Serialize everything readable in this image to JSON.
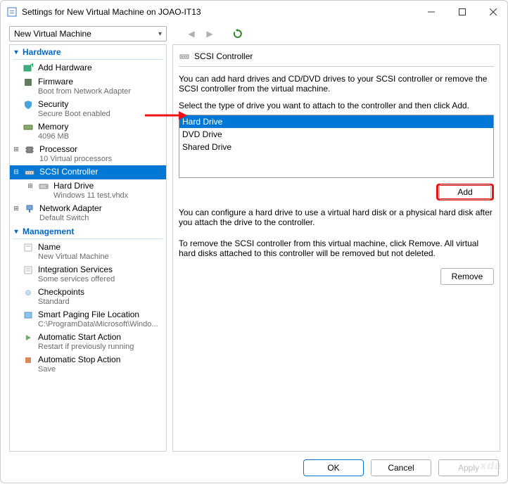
{
  "window": {
    "title": "Settings for New Virtual Machine on JOAO-IT13"
  },
  "toolbar": {
    "vm_name": "New Virtual Machine"
  },
  "sections": {
    "hardware": "Hardware",
    "management": "Management"
  },
  "tree": {
    "add_hardware": "Add Hardware",
    "firmware": "Firmware",
    "firmware_sub": "Boot from Network Adapter",
    "security": "Security",
    "security_sub": "Secure Boot enabled",
    "memory": "Memory",
    "memory_sub": "4096 MB",
    "processor": "Processor",
    "processor_sub": "10 Virtual processors",
    "scsi": "SCSI Controller",
    "hard_drive": "Hard Drive",
    "hard_drive_sub": "Windows 11 test.vhdx",
    "net": "Network Adapter",
    "net_sub": "Default Switch",
    "name": "Name",
    "name_sub": "New Virtual Machine",
    "integ": "Integration Services",
    "integ_sub": "Some services offered",
    "check": "Checkpoints",
    "check_sub": "Standard",
    "smart": "Smart Paging File Location",
    "smart_sub": "C:\\ProgramData\\Microsoft\\Windo...",
    "astart": "Automatic Start Action",
    "astart_sub": "Restart if previously running",
    "astop": "Automatic Stop Action",
    "astop_sub": "Save"
  },
  "right": {
    "title": "SCSI Controller",
    "p1": "You can add hard drives and CD/DVD drives to your SCSI controller or remove the SCSI controller from the virtual machine.",
    "p2": "Select the type of drive you want to attach to the controller and then click Add.",
    "options": {
      "hd": "Hard Drive",
      "dvd": "DVD Drive",
      "shared": "Shared Drive"
    },
    "add": "Add",
    "p3": "You can configure a hard drive to use a virtual hard disk or a physical hard disk after you attach the drive to the controller.",
    "p4": "To remove the SCSI controller from this virtual machine, click Remove. All virtual hard disks attached to this controller will be removed but not deleted.",
    "remove": "Remove"
  },
  "footer": {
    "ok": "OK",
    "cancel": "Cancel",
    "apply": "Apply"
  },
  "watermark": "xda"
}
